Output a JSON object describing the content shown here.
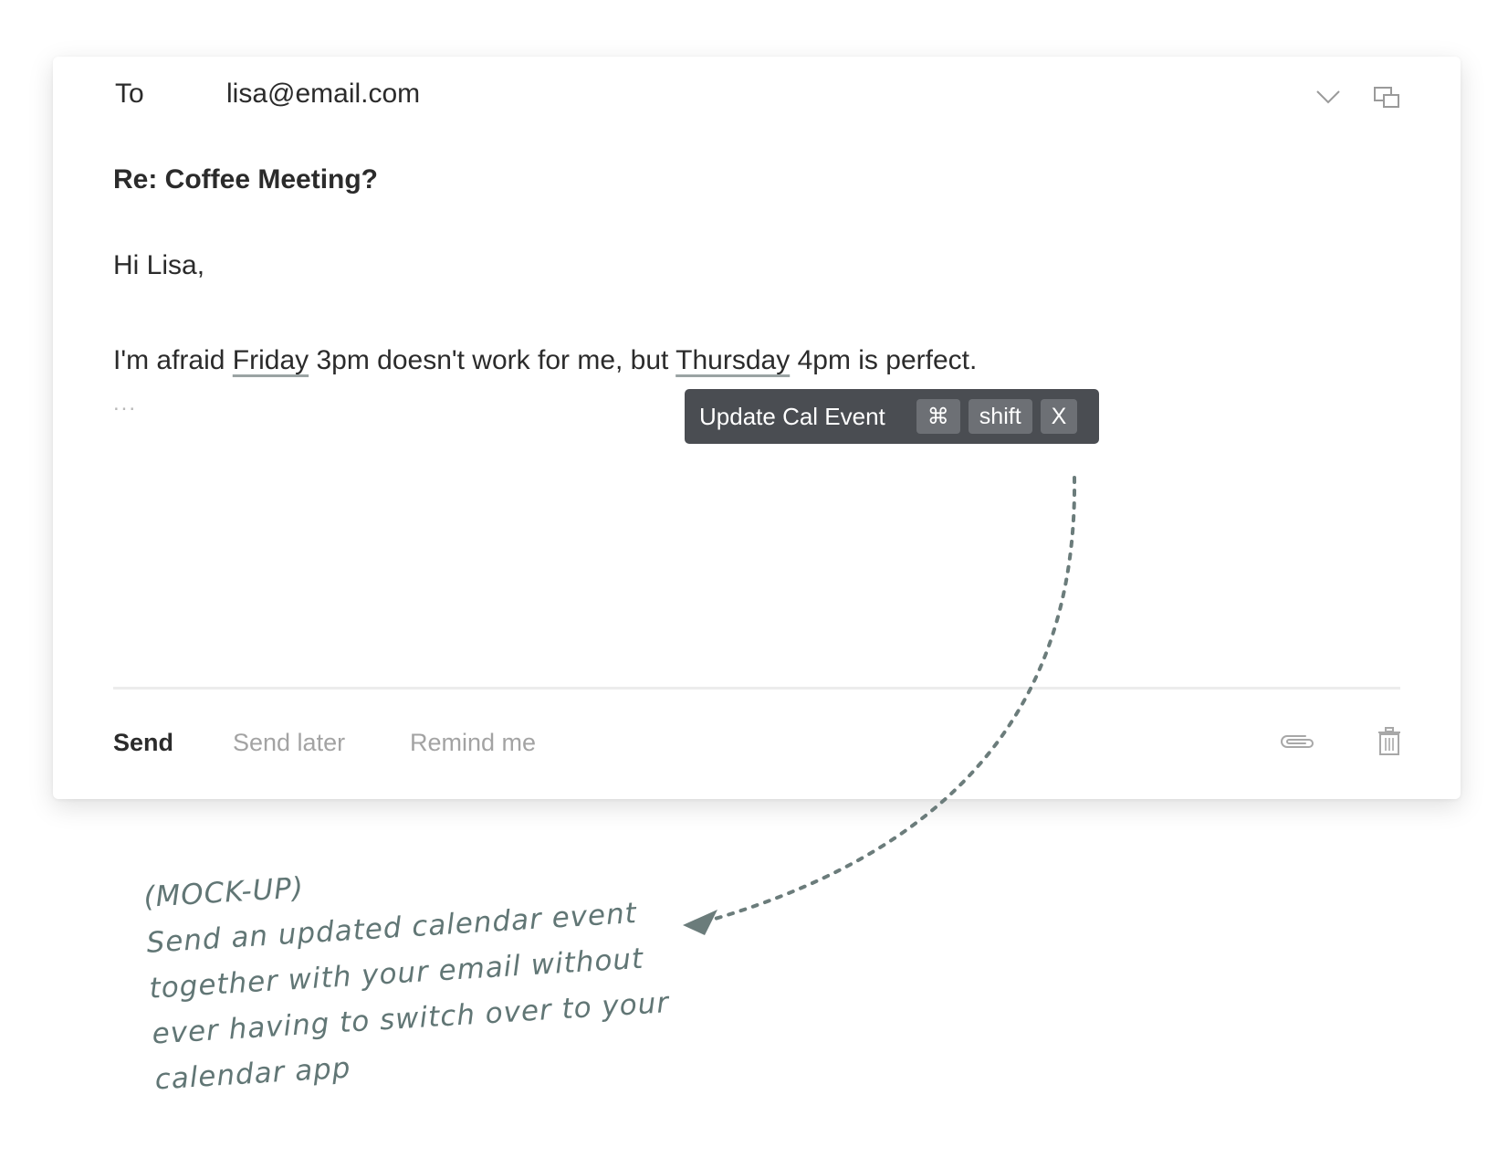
{
  "compose": {
    "to_label": "To",
    "to_value": "lisa@email.com",
    "subject": "Re: Coffee Meeting?",
    "greeting": "Hi Lisa,",
    "body": {
      "part1": "I'm afraid ",
      "date1": "Friday",
      "part2": " 3pm doesn't work for me, but ",
      "date2": "Thursday",
      "part3": " 4pm is perfect."
    },
    "ellipsis": "..."
  },
  "tooltip": {
    "label": "Update Cal Event",
    "key_cmd": "⌘",
    "key_shift": "shift",
    "key_x": "X"
  },
  "footer": {
    "send": "Send",
    "send_later": "Send later",
    "remind": "Remind me"
  },
  "icons": {
    "chevron": "chevron-down-icon",
    "popout": "popout-window-icon",
    "attach": "paperclip-icon",
    "trash": "trash-icon"
  },
  "annotation": {
    "lines": [
      "(MOCK-UP)",
      "Send an updated calendar event",
      "together with your email without",
      "ever having to switch over to your",
      "calendar app"
    ]
  },
  "colors": {
    "tooltip_bg": "#4a4d52",
    "key_bg": "#6d7075",
    "annotation": "#617675"
  }
}
